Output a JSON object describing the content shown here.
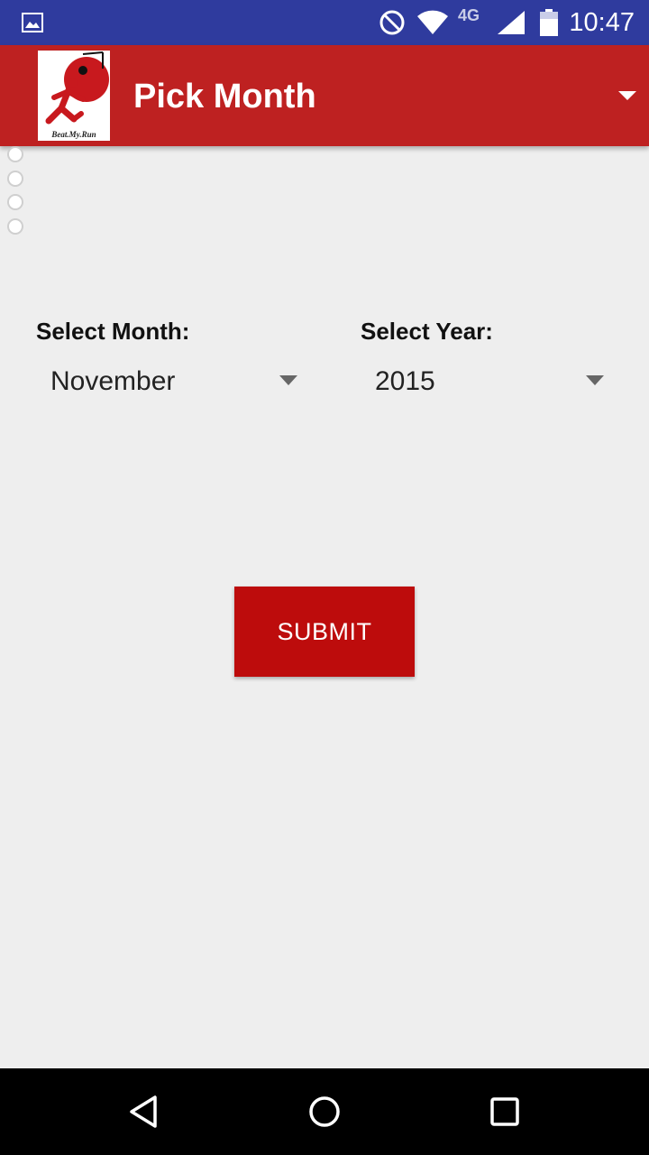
{
  "status_bar": {
    "time": "10:47",
    "network_label": "4G",
    "icons": [
      "image-icon",
      "do-not-disturb-icon",
      "wifi-icon",
      "cell-signal-icon",
      "battery-icon"
    ]
  },
  "app_bar": {
    "title": "Pick Month",
    "logo_caption": "Beat.My.Run",
    "menu_icon": "dropdown-triangle-icon",
    "color": "#be2121"
  },
  "radio_items": [
    {
      "checked": false
    },
    {
      "checked": false
    },
    {
      "checked": false
    },
    {
      "checked": false
    }
  ],
  "month_field": {
    "label": "Select Month:",
    "value": "November"
  },
  "year_field": {
    "label": "Select Year:",
    "value": "2015"
  },
  "submit": {
    "label": "SUBMIT",
    "color": "#bd0c0c"
  },
  "nav_bar": {
    "icons": [
      "back-icon",
      "home-icon",
      "recents-icon"
    ]
  }
}
